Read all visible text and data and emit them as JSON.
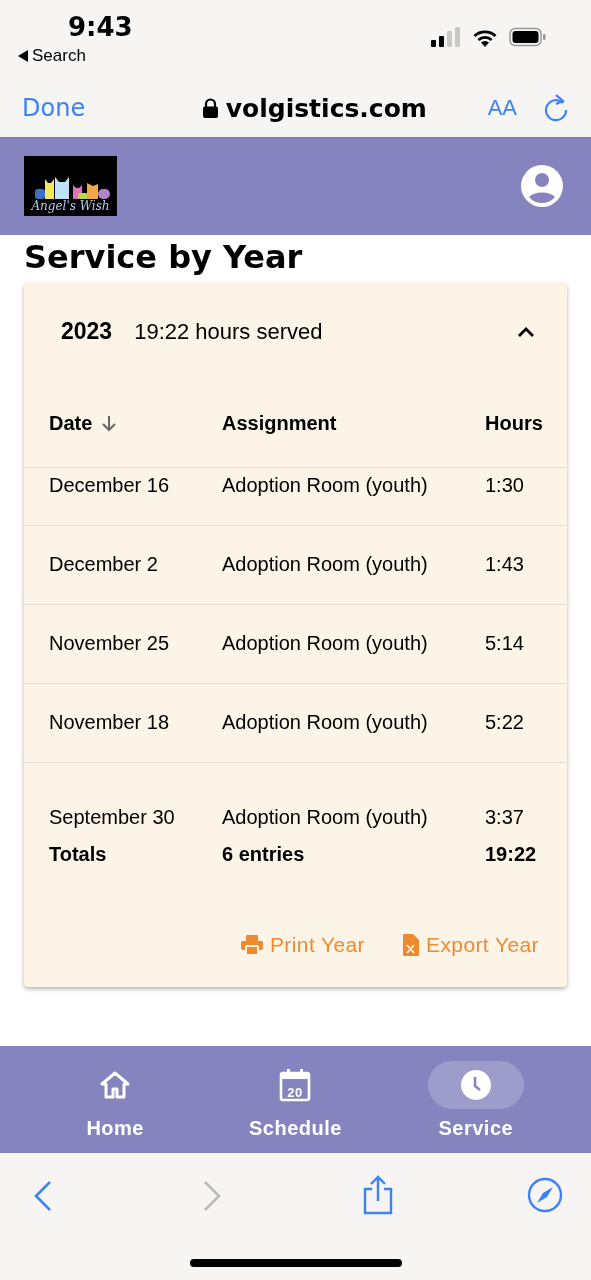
{
  "status_bar": {
    "time": "9:43",
    "back_label": "Search"
  },
  "browser": {
    "done": "Done",
    "address": "volgistics.com",
    "text_size": "AA"
  },
  "header": {
    "logo_text": "Angel's Wish"
  },
  "page": {
    "title": "Service by Year"
  },
  "year_card": {
    "year": "2023",
    "summary": "19:22 hours served",
    "expanded": true,
    "columns": [
      "Date",
      "Assignment",
      "Hours"
    ],
    "rows": [
      {
        "date": "December 16",
        "assignment": "Adoption Room (youth)",
        "hours": "1:30"
      },
      {
        "date": "December 2",
        "assignment": "Adoption Room (youth)",
        "hours": "1:43"
      },
      {
        "date": "November 25",
        "assignment": "Adoption Room (youth)",
        "hours": "5:14"
      },
      {
        "date": "November 18",
        "assignment": "Adoption Room (youth)",
        "hours": "5:22"
      },
      {
        "date": "September 30",
        "assignment": "Adoption Room (youth)",
        "hours": "3:37"
      }
    ],
    "totals": {
      "label": "Totals",
      "entries": "6 entries",
      "hours": "19:22"
    },
    "actions": [
      {
        "kind": "print",
        "label": "Print Year"
      },
      {
        "kind": "export",
        "label": "Export Year"
      }
    ]
  },
  "bottom_nav": [
    {
      "kind": "home",
      "label": "Home",
      "selected": false
    },
    {
      "kind": "calendar",
      "label": "Schedule",
      "icon_text": "20",
      "selected": false
    },
    {
      "kind": "clock",
      "label": "Service",
      "selected": true
    }
  ]
}
